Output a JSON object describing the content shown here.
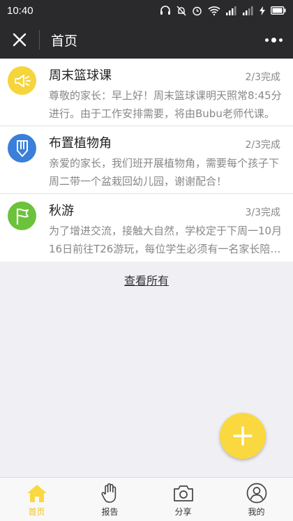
{
  "status_bar": {
    "time": "10:40"
  },
  "nav": {
    "title": "首页"
  },
  "items": [
    {
      "title": "周末篮球课",
      "status": "2/3完成",
      "description": "尊敬的家长：早上好！周末篮球课明天照常8:45分进行。由于工作安排需要，将由Bubu老师代课。",
      "icon": "megaphone-icon",
      "color": "#f6d53a"
    },
    {
      "title": "布置植物角",
      "status": "2/3完成",
      "description": "亲爱的家长，我们班开展植物角，需要每个孩子下周二带一个盆栽回幼儿园，谢谢配合！",
      "icon": "pencil-icon",
      "color": "#3a7fd9"
    },
    {
      "title": "秋游",
      "status": "3/3完成",
      "description": "为了增进交流，接触大自然，学校定于下周一10月16日前往T26游玩，每位学生必须有一名家长陪同。",
      "icon": "flag-icon",
      "color": "#6ac33a"
    }
  ],
  "view_all": "查看所有",
  "tabs": [
    {
      "label": "首页",
      "icon": "home-icon",
      "active": true
    },
    {
      "label": "报告",
      "icon": "hand-icon",
      "active": false
    },
    {
      "label": "分享",
      "icon": "camera-icon",
      "active": false
    },
    {
      "label": "我的",
      "icon": "user-icon",
      "active": false
    }
  ],
  "colors": {
    "accent": "#f9d93f",
    "active_tab": "#f4c21d",
    "nav_bg": "#2a2a2c"
  }
}
